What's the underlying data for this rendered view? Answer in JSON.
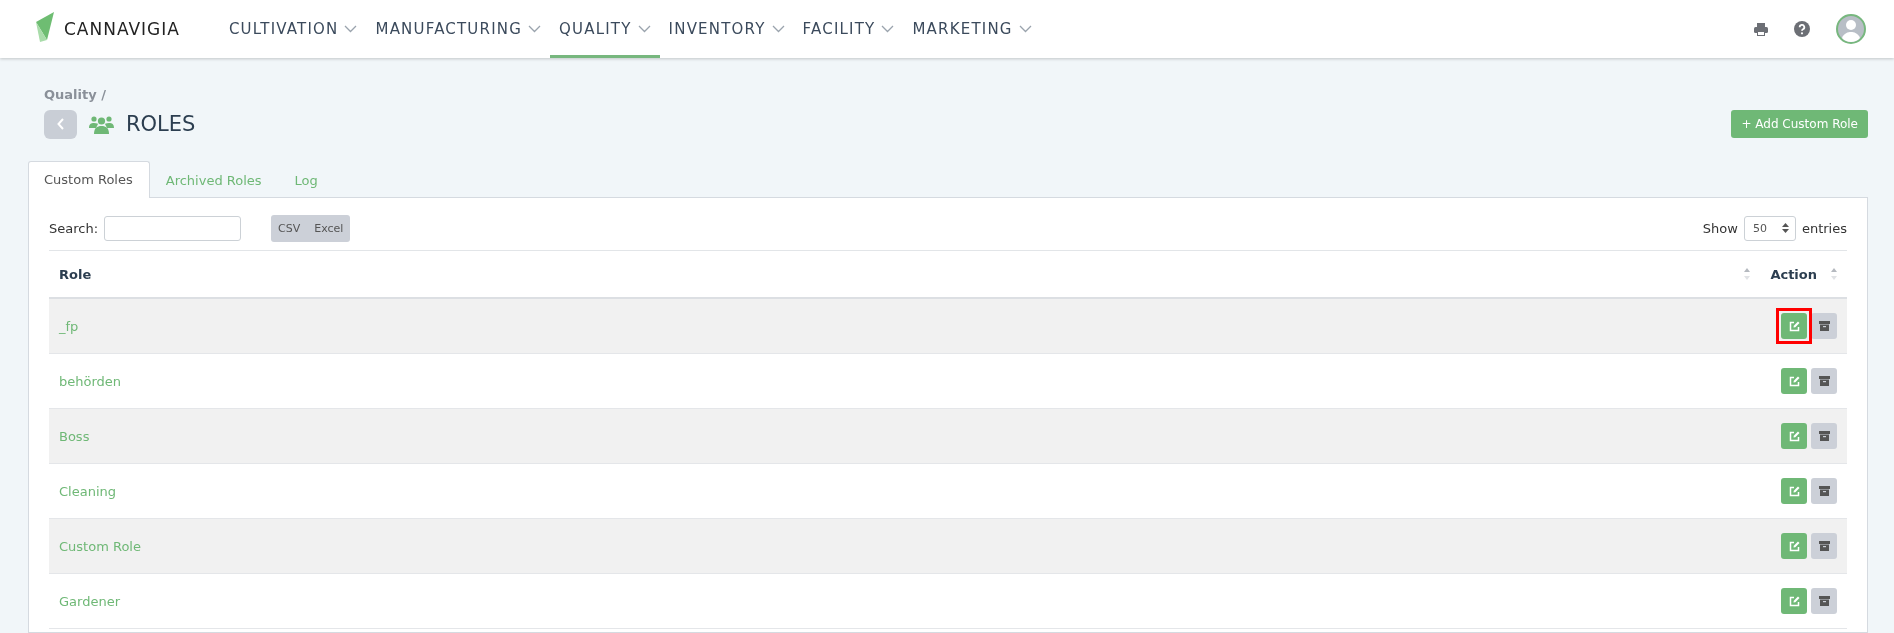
{
  "navbar": {
    "brand": "CANNAVIGIA",
    "menu": [
      {
        "label": "CULTIVATION",
        "selected": false
      },
      {
        "label": "MANUFACTURING",
        "selected": false
      },
      {
        "label": "QUALITY",
        "selected": true
      },
      {
        "label": "INVENTORY",
        "selected": false
      },
      {
        "label": "FACILITY",
        "selected": false
      },
      {
        "label": "MARKETING",
        "selected": false
      }
    ]
  },
  "breadcrumb": "Quality /",
  "title": "ROLES",
  "add_button": "+ Add Custom Role",
  "tabs": [
    {
      "label": "Custom Roles",
      "selected": true
    },
    {
      "label": "Archived Roles",
      "selected": false
    },
    {
      "label": "Log",
      "selected": false
    }
  ],
  "search": {
    "label": "Search:"
  },
  "export_buttons": [
    "CSV",
    "Excel"
  ],
  "page_length": {
    "label_before": "Show",
    "value": "50",
    "label_after": "entries"
  },
  "table": {
    "columns": [
      "Role",
      "Action"
    ],
    "rows": [
      {
        "role": "_fp",
        "highlighted": true
      },
      {
        "role": "behörden",
        "highlighted": false
      },
      {
        "role": "Boss",
        "highlighted": false
      },
      {
        "role": "Cleaning",
        "highlighted": false
      },
      {
        "role": "Custom Role",
        "highlighted": false
      },
      {
        "role": "Gardener",
        "highlighted": false
      }
    ]
  }
}
